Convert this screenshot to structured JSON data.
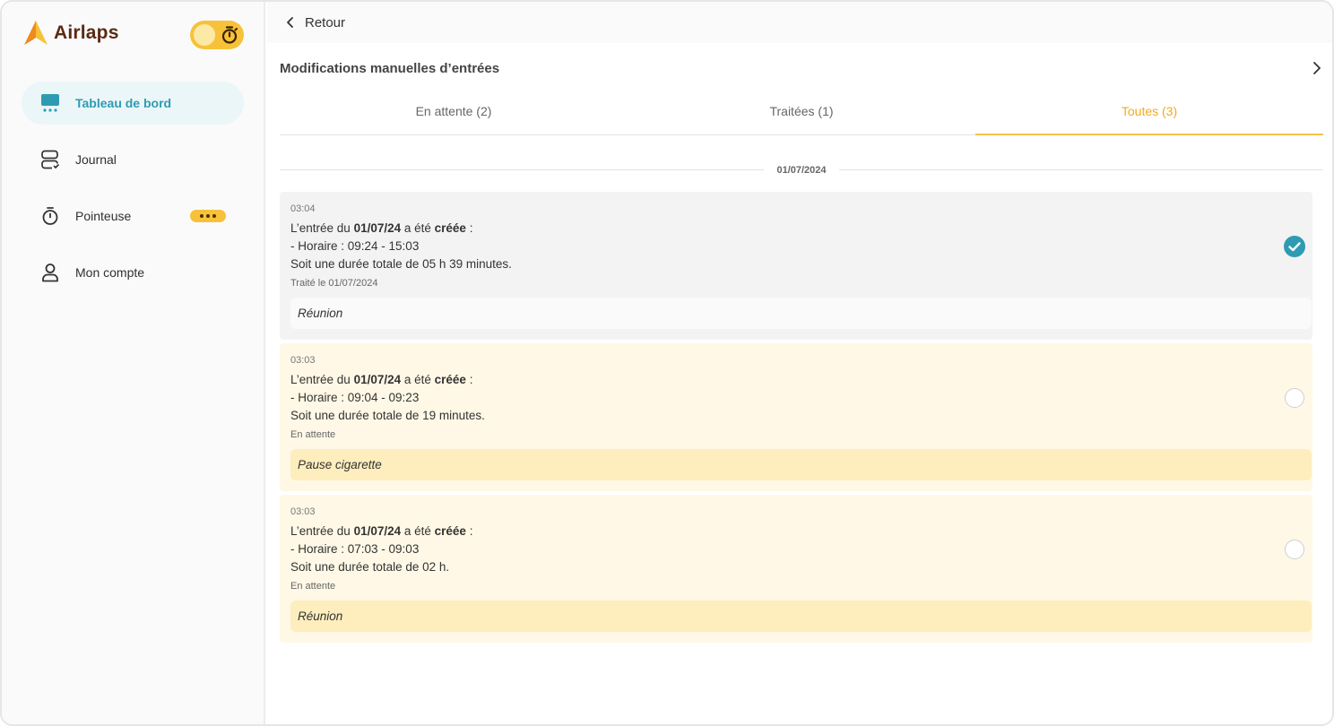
{
  "brand": {
    "name": "Airlaps",
    "accent": "#f2a91e",
    "brand_color": "#5b2a15"
  },
  "sidebar": {
    "items": [
      {
        "label": "Tableau de bord",
        "icon": "dashboard-icon",
        "active": true
      },
      {
        "label": "Journal",
        "icon": "journal-icon",
        "active": false
      },
      {
        "label": "Pointeuse",
        "icon": "stopwatch-icon",
        "active": false
      },
      {
        "label": "Mon compte",
        "icon": "user-icon",
        "active": false
      }
    ]
  },
  "topbar": {
    "back_label": "Retour"
  },
  "section": {
    "title": "Modifications manuelles d’entrées"
  },
  "tabs": [
    {
      "label": "En attente (2)",
      "active": false
    },
    {
      "label": "Traitées (1)",
      "active": false
    },
    {
      "label": "Toutes (3)",
      "active": true
    }
  ],
  "date_group": "01/07/2024",
  "entries": [
    {
      "time": "03:04",
      "prefix": "L’entrée du ",
      "date": "01/07/24",
      "middle": " a été ",
      "action": "créée",
      "suffix": " :",
      "schedule": "- Horaire : 09:24 - 15:03",
      "duration": "Soit une durée totale de 05 h 39 minutes.",
      "status": "Traité le 01/07/2024",
      "reason": "Réunion",
      "checked": true
    },
    {
      "time": "03:03",
      "prefix": "L’entrée du ",
      "date": "01/07/24",
      "middle": " a été ",
      "action": "créée",
      "suffix": " :",
      "schedule": "- Horaire : 09:04 - 09:23",
      "duration": "Soit une durée totale de 19 minutes.",
      "status": "En attente",
      "reason": "Pause cigarette",
      "checked": false
    },
    {
      "time": "03:03",
      "prefix": "L’entrée du ",
      "date": "01/07/24",
      "middle": " a été ",
      "action": "créée",
      "suffix": " :",
      "schedule": "- Horaire : 07:03 - 09:03",
      "duration": "Soit une durée totale de 02 h.",
      "status": "En attente",
      "reason": "Réunion",
      "checked": false
    }
  ]
}
